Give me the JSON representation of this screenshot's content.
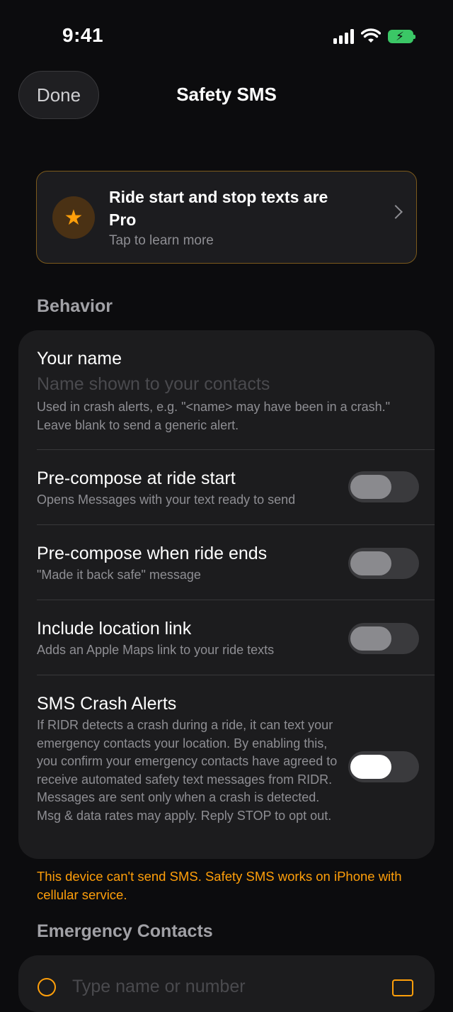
{
  "status": {
    "time": "9:41"
  },
  "nav": {
    "done_label": "Done",
    "title": "Safety SMS"
  },
  "pro_banner": {
    "title": "Ride start and stop texts are Pro",
    "subtitle": "Tap to learn more",
    "icon": "star-icon",
    "accent_color": "#ff9f0a"
  },
  "sections": {
    "behavior": "Behavior",
    "emergency_contacts": "Emergency Contacts"
  },
  "name_field": {
    "label": "Your name",
    "value": "",
    "placeholder": "Name shown to your contacts",
    "help": "Used in crash alerts, e.g. \"<name> may have been in a crash.\" Leave blank to send a generic alert."
  },
  "settings": [
    {
      "title": "Pre-compose at ride start",
      "subtitle": "Opens Messages with your text ready to send",
      "enabled": false
    },
    {
      "title": "Pre-compose when ride ends",
      "subtitle": "\"Made it back safe\" message",
      "enabled": false
    },
    {
      "title": "Include location link",
      "subtitle": "Adds an Apple Maps link to your ride texts",
      "enabled": false
    },
    {
      "title": "SMS Crash Alerts",
      "subtitle": "If RIDR detects a crash during a ride, it can text your emergency contacts your location. By enabling this, you confirm your emergency contacts have agreed to receive automated safety text messages from RIDR. Messages are sent only when a crash is detected. Msg & data rates may apply. Reply STOP to opt out.",
      "enabled": false
    }
  ],
  "warning": "This device can't send SMS. Safety SMS works on iPhone with cellular service.",
  "contacts": {
    "placeholder": "Type name or number"
  }
}
